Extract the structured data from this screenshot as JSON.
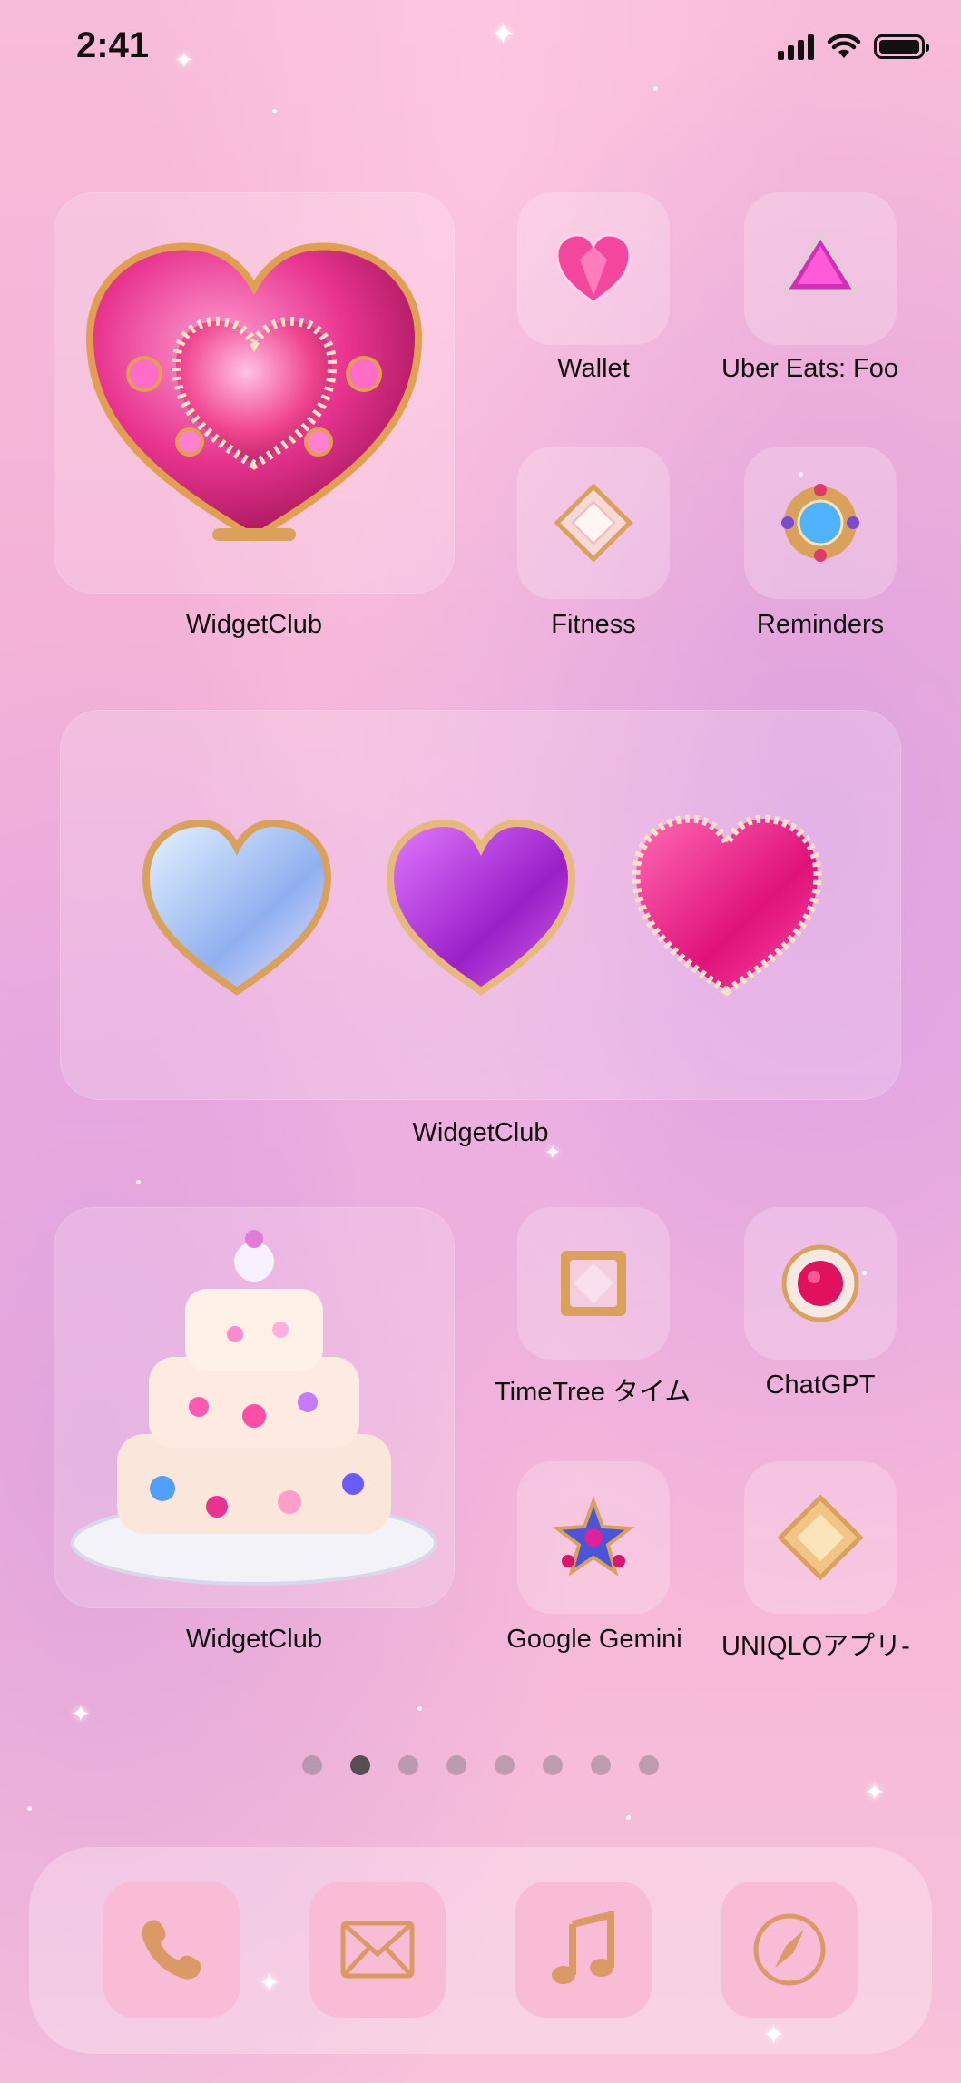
{
  "status_bar": {
    "time": "2:41"
  },
  "widgets": [
    {
      "label": "WidgetClub"
    },
    {
      "label": "WidgetClub"
    },
    {
      "label": "WidgetClub"
    }
  ],
  "apps": {
    "wallet": "Wallet",
    "uber_eats": "Uber Eats: Foo",
    "fitness": "Fitness",
    "reminders": "Reminders",
    "timetree": "TimeTree タイム",
    "chatgpt": "ChatGPT",
    "gemini": "Google Gemini",
    "uniqlo": "UNIQLOアプリ-"
  },
  "pager": {
    "pages": 8,
    "active_index": 1
  },
  "dock": [
    "phone-icon",
    "mail-icon",
    "music-icon",
    "compass-icon"
  ],
  "colors": {
    "accent_pink": "#e91e8c",
    "gold": "#d9a15a",
    "background": "#f3b2d6"
  }
}
